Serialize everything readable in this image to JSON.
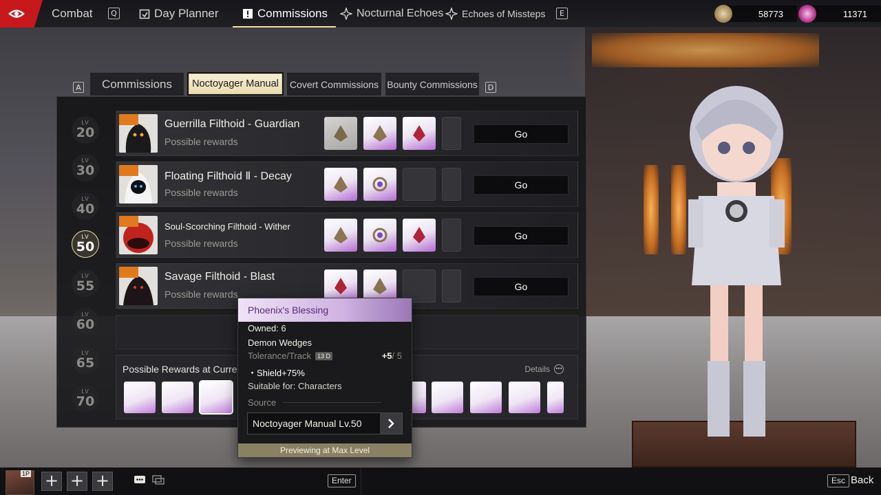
{
  "topbar": {
    "nav": [
      {
        "label": "Combat",
        "key": "Q"
      },
      {
        "label": "Day Planner"
      },
      {
        "label": "Commissions",
        "active": true
      },
      {
        "label": "Nocturnal Echoes"
      },
      {
        "label": "Echoes of Missteps",
        "key": "E"
      }
    ],
    "currency": [
      {
        "icon": "coin-icon",
        "value": "58773"
      },
      {
        "icon": "crystal-icon",
        "value": "11371"
      }
    ]
  },
  "tabs": {
    "left_key": "A",
    "right_key": "D",
    "items": [
      {
        "label": "Commissions"
      },
      {
        "label": "Noctoyager Manual",
        "active": true
      },
      {
        "label": "Covert Commissions"
      },
      {
        "label": "Bounty Commissions"
      }
    ]
  },
  "levels": [
    {
      "tag": "LV",
      "num": "20"
    },
    {
      "tag": "LV",
      "num": "30"
    },
    {
      "tag": "LV",
      "num": "40"
    },
    {
      "tag": "LV",
      "num": "50",
      "active": true
    },
    {
      "tag": "LV",
      "num": "55"
    },
    {
      "tag": "LV",
      "num": "60"
    },
    {
      "tag": "LV",
      "num": "65"
    },
    {
      "tag": "LV",
      "num": "70"
    }
  ],
  "rows": [
    {
      "name": "Guerrilla Filthoid - Guardian",
      "rewards_label": "Possible rewards",
      "go": "Go"
    },
    {
      "name": "Floating Filthoid Ⅱ - Decay",
      "rewards_label": "Possible rewards",
      "go": "Go"
    },
    {
      "name": "Soul-Scorching Filthoid - Wither",
      "rewards_label": "Possible rewards",
      "go": "Go"
    },
    {
      "name": "Savage Filthoid - Blast",
      "rewards_label": "Possible rewards",
      "go": "Go"
    }
  ],
  "possible": {
    "title": "Possible Rewards at Curren",
    "details": "Details"
  },
  "tooltip": {
    "title": "Phoenix's Blessing",
    "owned": "Owned: 6",
    "item": "Demon Wedges",
    "tolerance_label": "Tolerance/Track",
    "track_badge": "13 D",
    "tolerance_value": "+5",
    "tolerance_max": "/ 5",
    "effect": "・Shield+75%",
    "suitable": "Suitable for: Characters",
    "source_label": "Source",
    "source_link": "Noctoyager Manual Lv.50",
    "footer": "Previewing at Max Level"
  },
  "bottom": {
    "player_tag": "1P",
    "enter_key": "Enter",
    "esc_key": "Esc",
    "back_label": "Back"
  }
}
